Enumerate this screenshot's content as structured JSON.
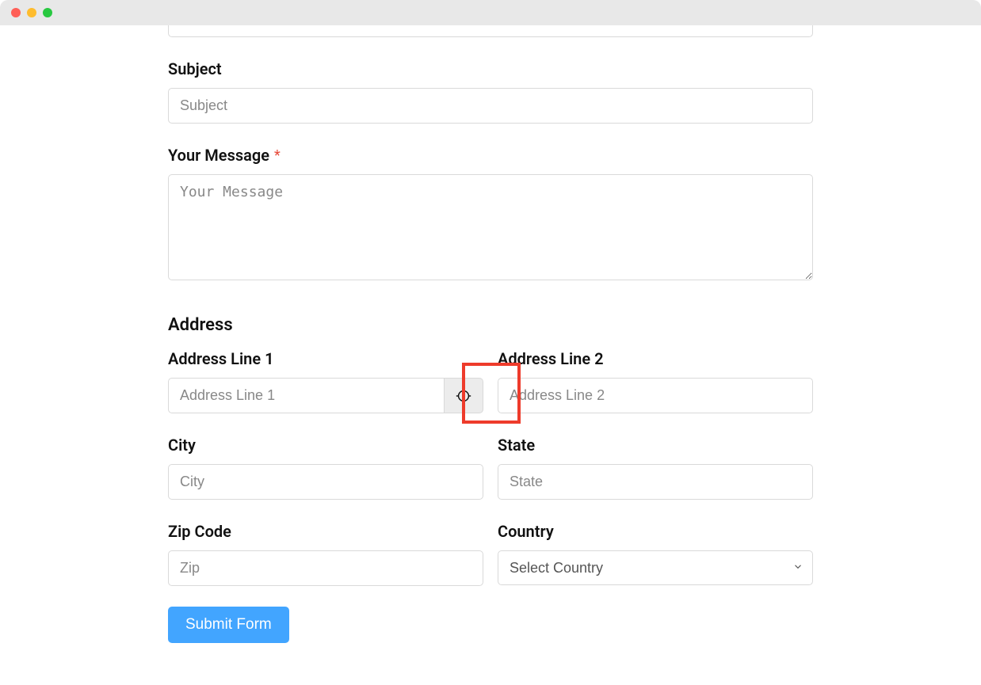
{
  "fields": {
    "subject": {
      "label": "Subject",
      "placeholder": "Subject"
    },
    "message": {
      "label": "Your Message",
      "required_mark": "*",
      "placeholder": "Your Message"
    },
    "address_section": "Address",
    "addr1": {
      "label": "Address Line 1",
      "placeholder": "Address Line 1"
    },
    "addr2": {
      "label": "Address Line 2",
      "placeholder": "Address Line 2"
    },
    "city": {
      "label": "City",
      "placeholder": "City"
    },
    "state": {
      "label": "State",
      "placeholder": "State"
    },
    "zip": {
      "label": "Zip Code",
      "placeholder": "Zip"
    },
    "country": {
      "label": "Country",
      "selected": "Select Country"
    }
  },
  "actions": {
    "submit": "Submit Form"
  }
}
